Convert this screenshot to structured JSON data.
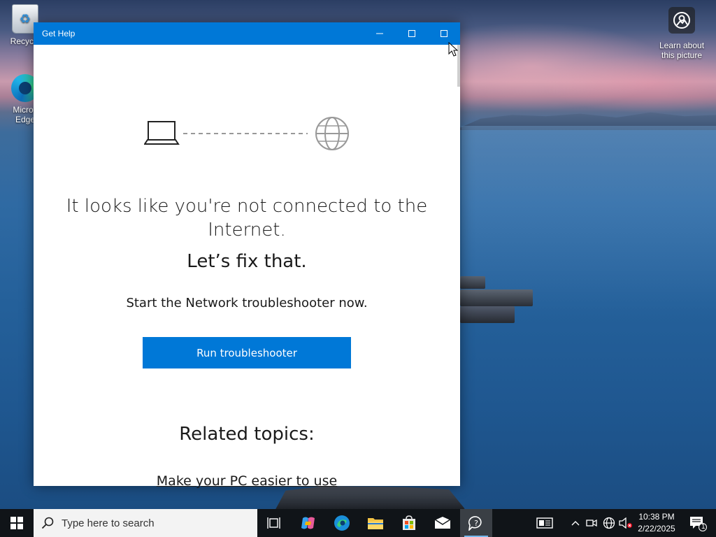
{
  "desktop": {
    "recycle_label": "Recycle",
    "edge_label_line1": "Micros",
    "edge_label_line2": "Edge",
    "learn_line1": "Learn about",
    "learn_line2": "this picture"
  },
  "window": {
    "title": "Get Help",
    "controls": [
      "minimize-icon",
      "maximize-icon",
      "maximize-icon"
    ],
    "heading_line1": "It looks like you're not connected to the",
    "heading_line2": "Internet.",
    "subheading": "Let’s fix that.",
    "prompt": "Start the Network troubleshooter now.",
    "run_button_label": "Run troubleshooter",
    "related_heading": "Related topics:",
    "related_links": [
      "Make your PC easier to use"
    ],
    "accent_color": "#0078d7"
  },
  "taskbar": {
    "search_placeholder": "Type here to search",
    "pinned": [
      "task-view-icon",
      "copilot-icon",
      "edge-icon",
      "file-explorer-icon",
      "store-icon",
      "mail-icon",
      "get-help-icon"
    ],
    "active_app": "get-help-icon",
    "tray": [
      "news-icon",
      "chevron-up-icon",
      "meet-now-icon",
      "network-icon",
      "volume-muted-icon"
    ],
    "time": "10:38 PM",
    "date": "2/22/2025",
    "notification_count": "1"
  }
}
